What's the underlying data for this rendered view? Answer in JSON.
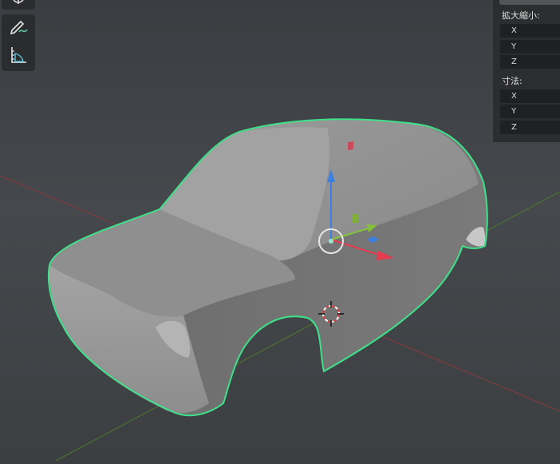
{
  "tools": [
    {
      "icon": "cursor-icon"
    },
    {
      "icon": "annotate-icon"
    },
    {
      "icon": "measure-icon"
    }
  ],
  "transform_panel": {
    "scale_label": "拡大縮小:",
    "scale_axes": [
      "X",
      "Y",
      "Z"
    ],
    "dimensions_label": "寸法:",
    "dimension_axes": [
      "X",
      "Y",
      "Z"
    ]
  },
  "colors": {
    "selection_outline": "#3fe08a",
    "axis_x": "#e53b4f",
    "axis_y": "#84c23d",
    "axis_z": "#3b7ee5",
    "grid_red": "#8a3a3a",
    "grid_green": "#4d7a2e"
  }
}
